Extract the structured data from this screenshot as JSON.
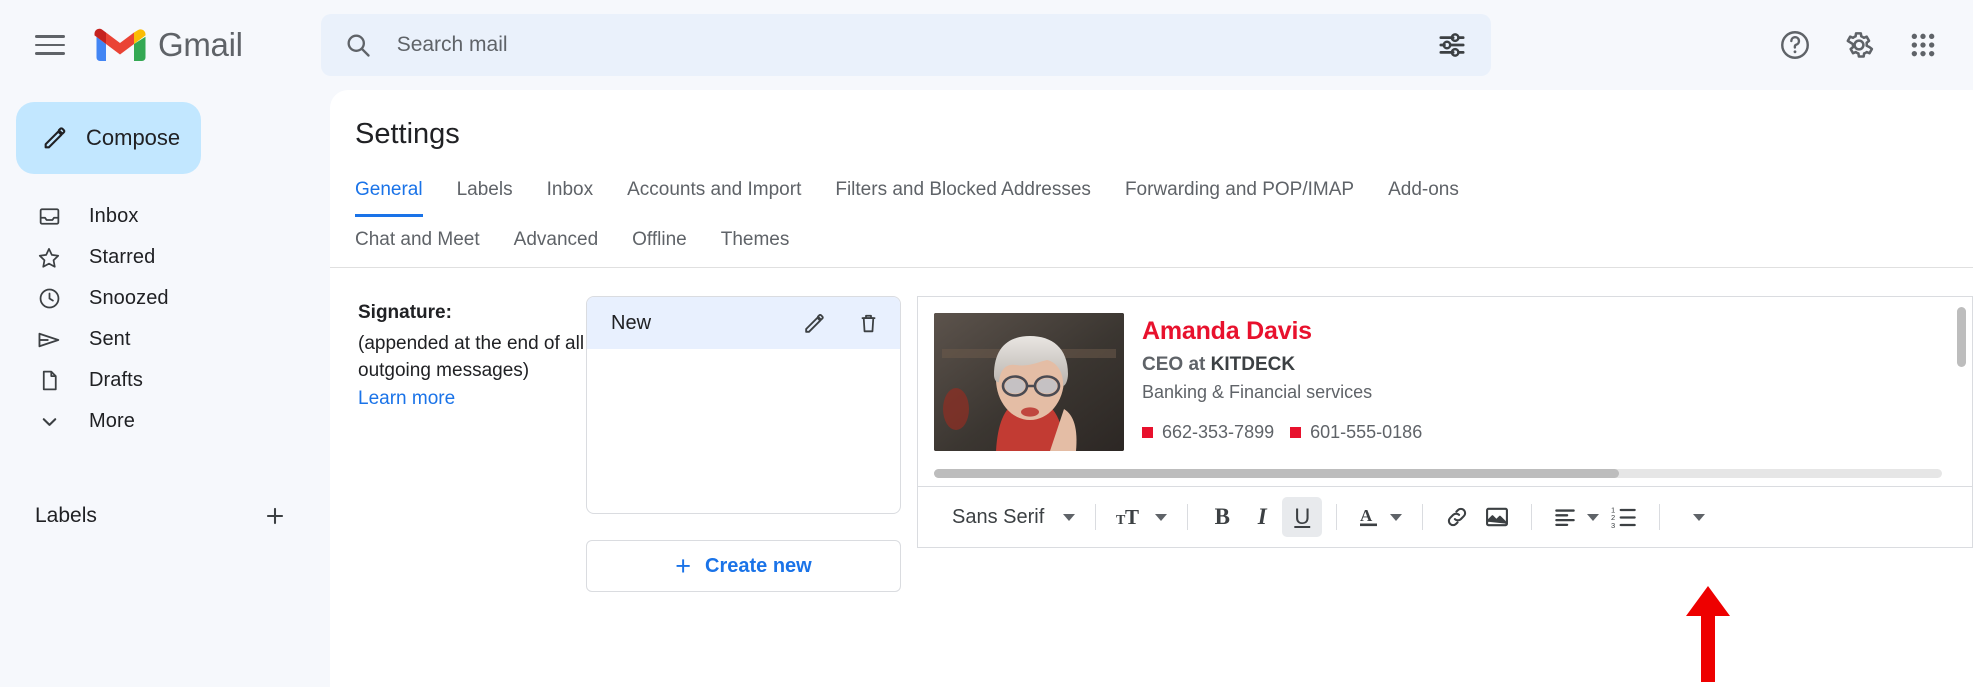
{
  "brand": {
    "name": "Gmail"
  },
  "search": {
    "placeholder": "Search mail",
    "value": ""
  },
  "topbar": {
    "menu_icon": "hamburger-menu-icon",
    "search_icon": "search-icon",
    "tune_icon": "search-options-icon",
    "help_icon": "help-icon",
    "settings_icon": "gear-icon",
    "apps_icon": "google-apps-grid-icon"
  },
  "sidebar": {
    "compose": {
      "label": "Compose",
      "icon": "pencil-icon"
    },
    "items": [
      {
        "label": "Inbox",
        "icon": "inbox-icon"
      },
      {
        "label": "Starred",
        "icon": "star-icon"
      },
      {
        "label": "Snoozed",
        "icon": "clock-icon"
      },
      {
        "label": "Sent",
        "icon": "send-icon"
      },
      {
        "label": "Drafts",
        "icon": "document-icon"
      },
      {
        "label": "More",
        "icon": "chevron-down-icon"
      }
    ],
    "labels": {
      "title": "Labels",
      "add_icon": "plus-icon"
    }
  },
  "settings": {
    "title": "Settings",
    "tabs_row1": [
      {
        "label": "General",
        "active": true
      },
      {
        "label": "Labels",
        "active": false
      },
      {
        "label": "Inbox",
        "active": false
      },
      {
        "label": "Accounts and Import",
        "active": false
      },
      {
        "label": "Filters and Blocked Addresses",
        "active": false
      },
      {
        "label": "Forwarding and POP/IMAP",
        "active": false
      },
      {
        "label": "Add-ons",
        "active": false
      }
    ],
    "tabs_row2": [
      {
        "label": "Chat and Meet",
        "active": false
      },
      {
        "label": "Advanced",
        "active": false
      },
      {
        "label": "Offline",
        "active": false
      },
      {
        "label": "Themes",
        "active": false
      }
    ]
  },
  "signature": {
    "label": "Signature:",
    "description": "(appended at the end of all outgoing messages)",
    "learn_more": "Learn more",
    "list": [
      {
        "name": "New",
        "edit_icon": "pencil-icon",
        "delete_icon": "trash-icon",
        "selected": true
      }
    ],
    "create_new": {
      "label": "Create new",
      "icon": "plus-icon"
    },
    "preview": {
      "photo_alt": "portrait-photo",
      "name": "Amanda Davis",
      "role_prefix": "CEO at ",
      "company": "KITDECK",
      "industry": "Banking & Financial services",
      "phones": [
        "662-353-7899",
        "601-555-0186"
      ],
      "bullet_color": "#e8112d",
      "name_color": "#e8112d"
    },
    "toolbar": {
      "font_name": "Sans Serif",
      "size_icon": "text-size-icon",
      "bold_label": "B",
      "italic_label": "I",
      "underline_label": "U",
      "text_color_label": "A",
      "link_icon": "link-icon",
      "image_icon": "insert-image-icon",
      "align_icon": "align-left-icon",
      "list_icon": "numbered-list-icon",
      "more_icon": "more-options-icon",
      "underline_active": true
    }
  },
  "annotation": {
    "arrow": "red-arrow-pointing-to-insert-image",
    "color": "#ee0000"
  }
}
